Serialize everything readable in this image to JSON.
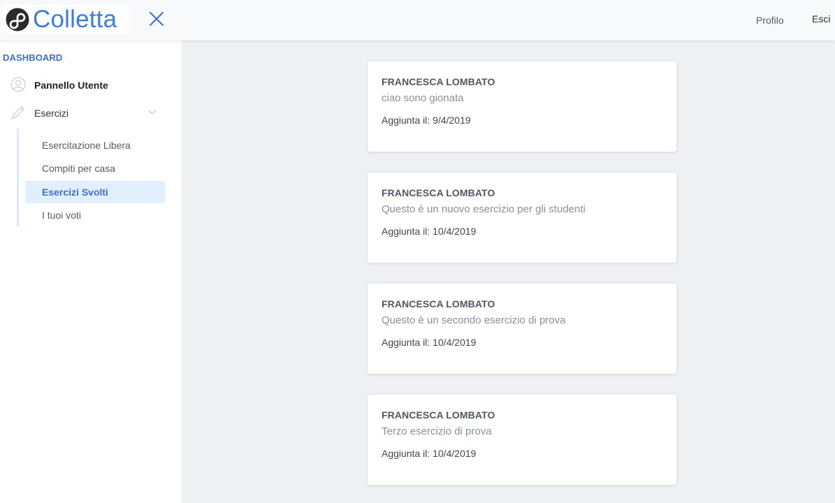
{
  "app": {
    "brand": "Colletta"
  },
  "topbar": {
    "profile_label": "Profilo",
    "logout_label": "Esci"
  },
  "sidebar": {
    "heading": "DASHBOARD",
    "items": [
      {
        "label": "Pannello Utente",
        "icon": "user-icon"
      },
      {
        "label": "Esercizi",
        "icon": "pencil-icon",
        "expanded": true
      }
    ],
    "subitems": [
      {
        "label": "Esercitazione Libera",
        "active": false
      },
      {
        "label": "Compiti per casa",
        "active": false
      },
      {
        "label": "Esercizi Svolti",
        "active": true
      },
      {
        "label": "I tuoi voti",
        "active": false
      }
    ]
  },
  "cards": [
    {
      "author": "FRANCESCA LOMBATO",
      "description": "ciao sono gionata",
      "added": "Aggiunta il: 9/4/2019"
    },
    {
      "author": "FRANCESCA LOMBATO",
      "description": "Questo è un nuovo esercizio per gli studenti",
      "added": "Aggiunta il: 10/4/2019"
    },
    {
      "author": "FRANCESCA LOMBATO",
      "description": "Questo è un secondo esercizio di prova",
      "added": "Aggiunta il: 10/4/2019"
    },
    {
      "author": "FRANCESCA LOMBATO",
      "description": "Terzo esercizio di prova",
      "added": "Aggiunta il: 10/4/2019"
    }
  ],
  "colors": {
    "accent": "#3b7ddd",
    "active_bg": "#e1effd",
    "page_bg": "#eef0f3"
  }
}
